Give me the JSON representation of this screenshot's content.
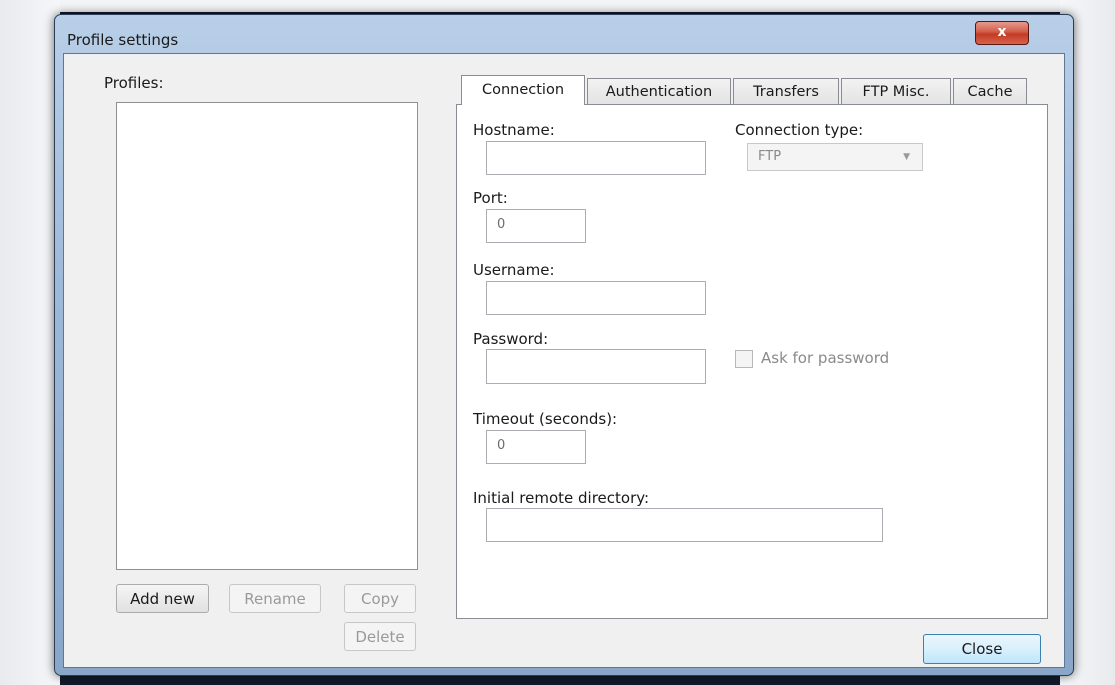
{
  "window": {
    "title": "Profile settings",
    "close_glyph": "x"
  },
  "profiles": {
    "label": "Profiles:",
    "items": [],
    "buttons": {
      "add_new": "Add new",
      "rename": "Rename",
      "copy": "Copy",
      "delete": "Delete"
    }
  },
  "tabs": [
    "Connection",
    "Authentication",
    "Transfers",
    "FTP Misc.",
    "Cache"
  ],
  "active_tab": "Connection",
  "connection": {
    "hostname_label": "Hostname:",
    "hostname_value": "",
    "connection_type_label": "Connection type:",
    "connection_type_value": "FTP",
    "port_label": "Port:",
    "port_value": "0",
    "username_label": "Username:",
    "username_value": "",
    "password_label": "Password:",
    "password_value": "",
    "ask_password_label": "Ask for password",
    "ask_password_checked": false,
    "timeout_label": "Timeout (seconds):",
    "timeout_value": "0",
    "initial_dir_label": "Initial remote directory:",
    "initial_dir_value": ""
  },
  "footer": {
    "close_label": "Close"
  },
  "colors": {
    "window_frame": "#9fb9d8",
    "close_button_red": "#c23a25",
    "primary_button_blue": "#bee6fd"
  },
  "icons": {
    "dropdown": "chevron-down-icon",
    "close": "close-icon"
  }
}
